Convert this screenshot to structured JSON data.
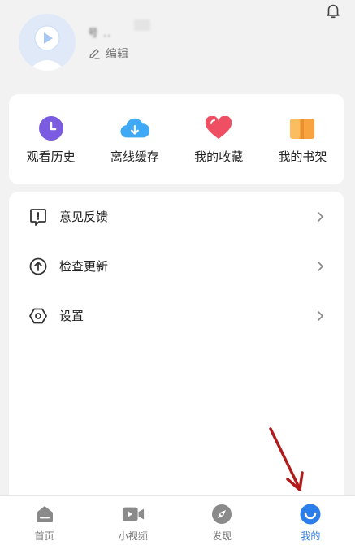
{
  "profile": {
    "name": "号 ..",
    "edit_label": "编辑"
  },
  "shortcuts": [
    {
      "label": "观看历史",
      "icon": "clock-icon",
      "color": "#7b5ce0"
    },
    {
      "label": "离线缓存",
      "icon": "cloud-download-icon",
      "color": "#3fa9f5"
    },
    {
      "label": "我的收藏",
      "icon": "heart-icon",
      "color": "#ef4f63"
    },
    {
      "label": "我的书架",
      "icon": "book-icon",
      "color": "#f8a340"
    }
  ],
  "menu": [
    {
      "label": "意见反馈",
      "icon": "feedback-icon"
    },
    {
      "label": "检查更新",
      "icon": "update-arrow-icon"
    },
    {
      "label": "设置",
      "icon": "settings-hexagon-icon"
    }
  ],
  "tabs": [
    {
      "label": "首页",
      "icon": "home-icon",
      "active": false
    },
    {
      "label": "小视频",
      "icon": "video-camera-icon",
      "active": false
    },
    {
      "label": "发现",
      "icon": "compass-icon",
      "active": false
    },
    {
      "label": "我的",
      "icon": "profile-smile-icon",
      "active": true
    }
  ],
  "colors": {
    "accent": "#2b7de9",
    "annotation_arrow": "#b01c1c",
    "background": "#f2f2f2"
  }
}
